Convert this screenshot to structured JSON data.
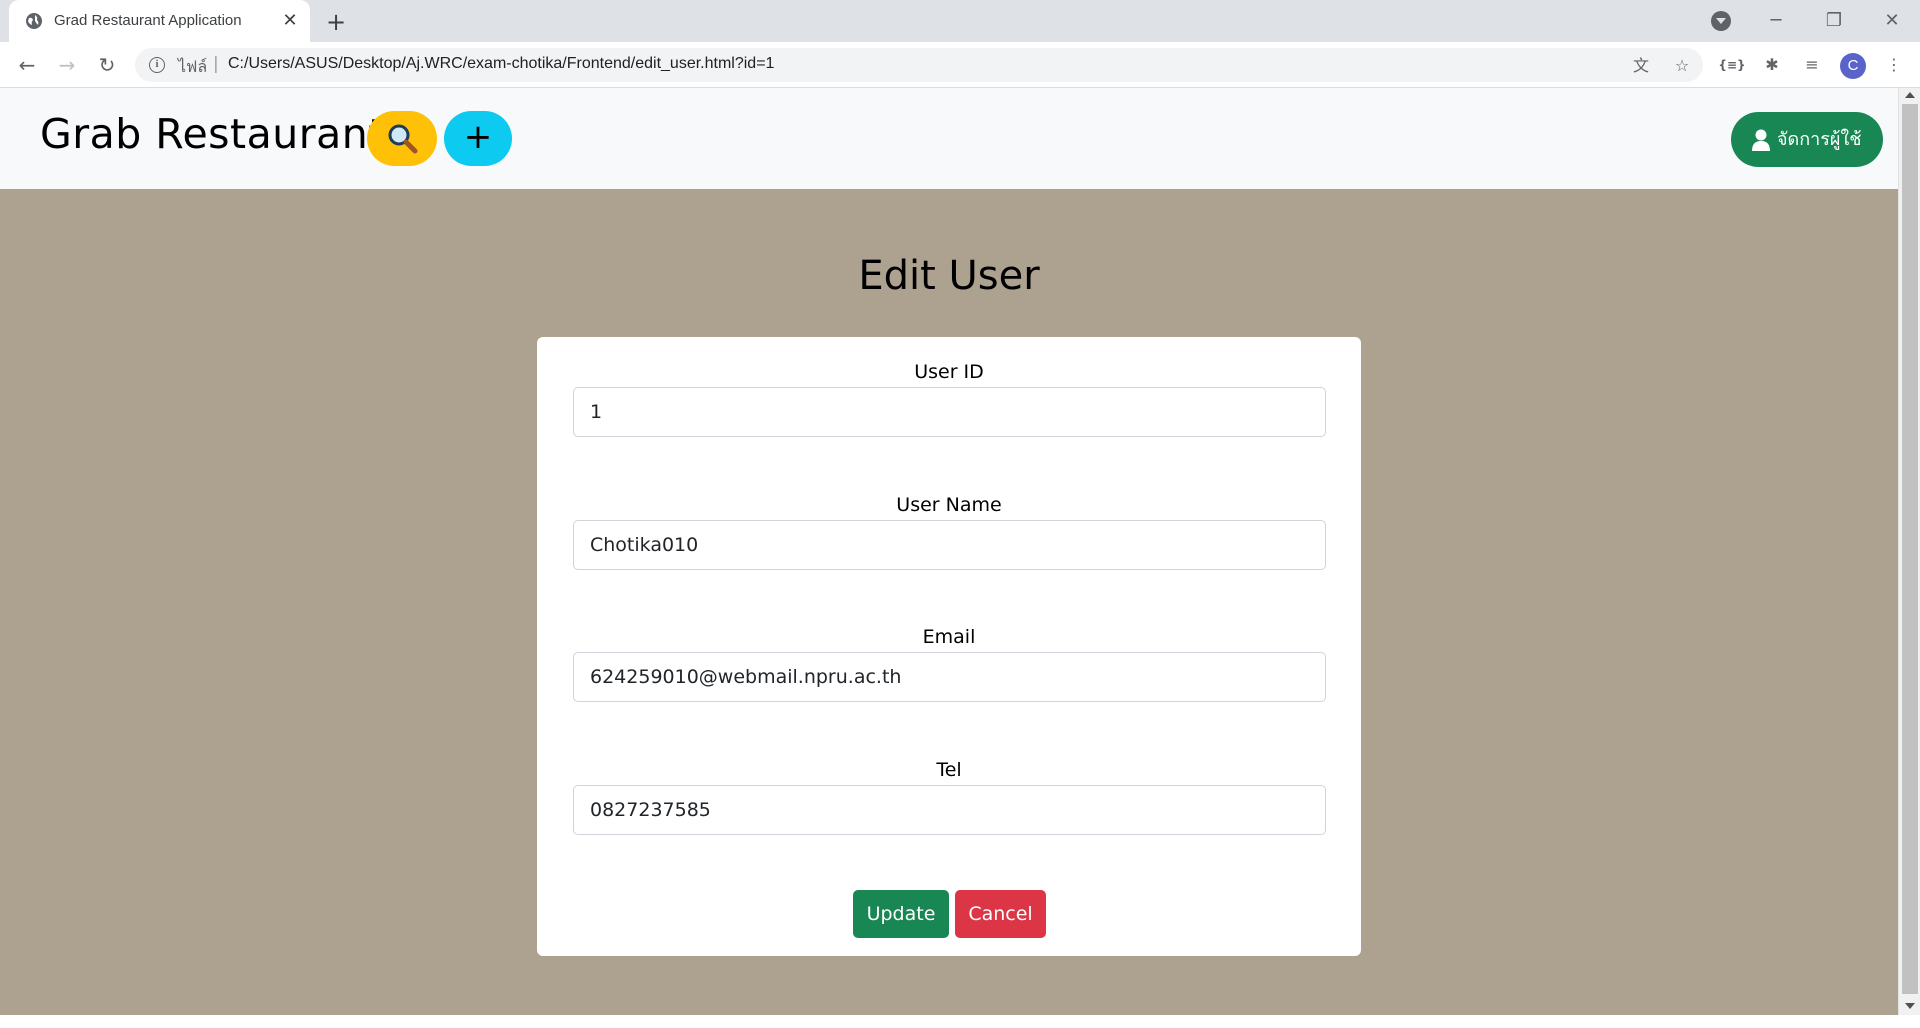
{
  "browser": {
    "tab_title": "Grad Restaurant Application",
    "url_scheme": "ไฟล์",
    "url": "C:/Users/ASUS/Desktop/Aj.WRC/exam-chotika/Frontend/edit_user.html?id=1",
    "profile_initial": "C",
    "new_tab_symbol": "+",
    "close_symbol": "✕"
  },
  "navbar": {
    "brand": "Grab Restaurant",
    "add_symbol": "+",
    "manage_users_label": "จัดการผู้ใช้"
  },
  "form": {
    "title": "Edit User",
    "fields": [
      {
        "label": "User ID",
        "value": "1"
      },
      {
        "label": "User Name",
        "value": "Chotika010"
      },
      {
        "label": "Email",
        "value": "624259010@webmail.npru.ac.th"
      },
      {
        "label": "Tel",
        "value": "0827237585"
      }
    ],
    "update_label": "Update",
    "cancel_label": "Cancel"
  },
  "colors": {
    "page_background": "#ada190",
    "search_button": "#ffc107",
    "add_button": "#0dcaf0",
    "success": "#198754",
    "danger": "#dc3545"
  }
}
